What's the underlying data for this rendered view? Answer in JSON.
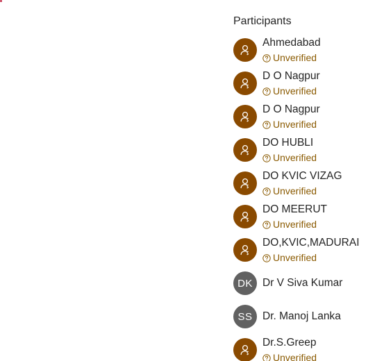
{
  "panel": {
    "title": "Participants"
  },
  "status_text": "Unverified",
  "colors": {
    "unverified_avatar": "#8a4a00",
    "initials_avatar": "#616161",
    "status_text": "#8a5a00"
  },
  "participants": [
    {
      "name": "Ahmedabad",
      "status": "Unverified",
      "avatar": "person-icon"
    },
    {
      "name": "D O Nagpur",
      "status": "Unverified",
      "avatar": "person-icon"
    },
    {
      "name": "D O Nagpur",
      "status": "Unverified",
      "avatar": "person-icon"
    },
    {
      "name": "DO HUBLI",
      "status": "Unverified",
      "avatar": "person-icon"
    },
    {
      "name": "DO KVIC VIZAG",
      "status": "Unverified",
      "avatar": "person-icon"
    },
    {
      "name": "DO MEERUT",
      "status": "Unverified",
      "avatar": "person-icon"
    },
    {
      "name": "DO,KVIC,MADURAI",
      "status": "Unverified",
      "avatar": "person-icon"
    },
    {
      "name": "Dr V Siva Kumar",
      "initials": "DK"
    },
    {
      "name": "Dr. Manoj Lanka",
      "initials": "SS"
    },
    {
      "name": "Dr.S.Greep",
      "status": "Unverified",
      "avatar": "person-icon"
    }
  ]
}
